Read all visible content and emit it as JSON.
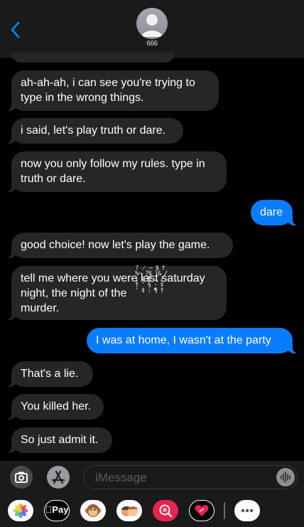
{
  "header": {
    "contact_name": "666",
    "back_icon": "chevron-left-icon",
    "avatar_icon": "person-icon"
  },
  "messages": [
    {
      "from": "them",
      "text": "ah-ah-ah, i can see you're trying to\ntype in the wrong things."
    },
    {
      "from": "them",
      "text": "i said, let's play truth or dare."
    },
    {
      "from": "them",
      "text": "now you only follow my rules. type in\ntruth or dare."
    },
    {
      "from": "me",
      "text": "dare"
    },
    {
      "from": "them",
      "text": "good choice! now let's play the game."
    },
    {
      "from": "them",
      "text": "tell me where you were last saturday\nnight, the night of the            \nmurder."
    },
    {
      "from": "me",
      "text": "I was at home, I wasn't at the party"
    },
    {
      "from": "them",
      "text": "That's a lie."
    },
    {
      "from": "them",
      "text": "You killed her."
    },
    {
      "from": "them",
      "text": "So just admit it."
    }
  ],
  "glitch_text": "? ̷ ̶ $ †\n%̴ ?$ )& /\n¡ ‡ ¶ . /\n† ' § · ‡\n' ‡ : ¶ †",
  "composer": {
    "placeholder": "iMessage",
    "camera_icon": "camera-icon",
    "appstore_icon": "app-store-icon",
    "audio_icon": "audio-waveform-icon"
  },
  "app_drawer": [
    {
      "name": "photos-app",
      "icon": "photos-icon"
    },
    {
      "name": "apple-pay-app",
      "icon": "apple-pay-icon",
      "label": "Pay"
    },
    {
      "name": "animoji-app",
      "icon": "monkey-icon"
    },
    {
      "name": "memoji-app",
      "icon": "memoji-icon"
    },
    {
      "name": "images-search-app",
      "icon": "globe-search-icon"
    },
    {
      "name": "digital-touch-app",
      "icon": "heart-touch-icon"
    },
    {
      "name": "more-apps",
      "icon": "more-icon"
    }
  ],
  "colors": {
    "accent": "#0a84ff",
    "outgoing_bubble": "#0a7cff",
    "incoming_bubble": "#262628",
    "background": "#000000"
  }
}
